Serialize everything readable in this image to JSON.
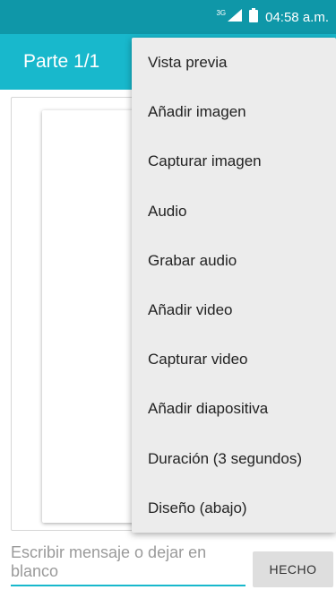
{
  "status_bar": {
    "network": "3G",
    "time": "04:58 a.m."
  },
  "app_bar": {
    "title": "Parte 1/1"
  },
  "menu": {
    "items": [
      {
        "label": "Vista previa"
      },
      {
        "label": "Añadir imagen"
      },
      {
        "label": "Capturar imagen"
      },
      {
        "label": "Audio"
      },
      {
        "label": "Grabar audio"
      },
      {
        "label": "Añadir video"
      },
      {
        "label": "Capturar video"
      },
      {
        "label": "Añadir diapositiva"
      },
      {
        "label": "Duración (3 segundos)"
      },
      {
        "label": "Diseño (abajo)"
      }
    ]
  },
  "compose": {
    "placeholder": "Escribir mensaje o dejar en blanco",
    "done_label": "HECHO"
  },
  "colors": {
    "status_bar": "#0f97a8",
    "app_bar": "#18b8cc",
    "accent": "#18b8cc",
    "menu_bg": "#ececec"
  }
}
